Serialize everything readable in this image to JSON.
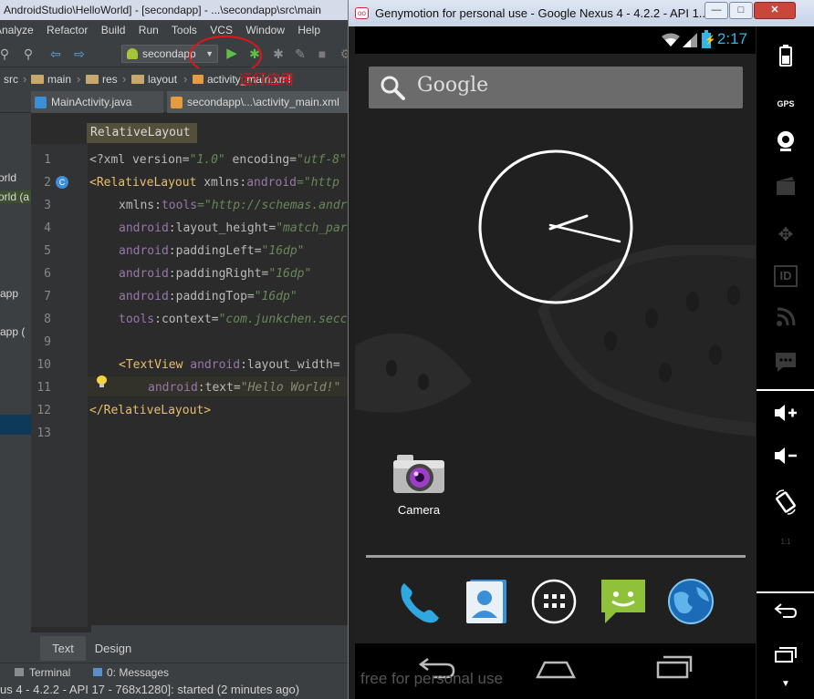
{
  "ide": {
    "title": "AndroidStudio\\HelloWorld] - [secondapp] - ...\\secondapp\\src\\main",
    "menu": [
      "Analyze",
      "Refactor",
      "Build",
      "Run",
      "Tools",
      "VCS",
      "Window",
      "Help"
    ],
    "run_config": "secondapp",
    "annotation": "运行应用",
    "breadcrumb": [
      "src",
      "main",
      "res",
      "layout",
      "activity_main.xml"
    ],
    "tabs": [
      "MainActivity.java",
      "secondapp\\...\\activity_main.xml"
    ],
    "project_items": [
      "orld",
      "orld (a",
      "app",
      "app ("
    ],
    "editor_crumb": "RelativeLayout",
    "line_numbers": [
      "1",
      "2",
      "3",
      "4",
      "5",
      "6",
      "7",
      "8",
      "9",
      "10",
      "11",
      "12",
      "13"
    ],
    "code": {
      "l1": {
        "a": "<?xml ",
        "b": "version=",
        "c": "\"1.0\"",
        "d": " encoding=",
        "e": "\"utf-8\""
      },
      "l2": {
        "tag": "<RelativeLayout",
        "ns": "android",
        "attr": " xmlns:",
        "val": "=\"http"
      },
      "l3": {
        "attr": "xmlns:",
        "ns": "tools",
        "val": "=\"http://schemas.andr"
      },
      "l4": {
        "ns": "android",
        "attr": ":layout_height=",
        "val": "\"match_par"
      },
      "l5": {
        "ns": "android",
        "attr": ":paddingLeft=",
        "val": "\"16dp\""
      },
      "l6": {
        "ns": "android",
        "attr": ":paddingRight=",
        "val": "\"16dp\""
      },
      "l7": {
        "ns": "android",
        "attr": ":paddingTop=",
        "val": "\"16dp\""
      },
      "l8": {
        "ns": "tools",
        "attr": ":context=",
        "val": "\"com.junkchen.secc"
      },
      "l10": {
        "tag": "<TextView",
        "ns": "android",
        "attr": ":layout_width="
      },
      "l11": {
        "ns": "android",
        "attr": ":text=",
        "val": "\"Hello World!\""
      },
      "l12": {
        "tag": "</RelativeLayout>"
      }
    },
    "bottom_tabs": [
      "Text",
      "Design"
    ],
    "tool_windows": [
      "Terminal",
      "0: Messages"
    ],
    "status": "us 4 - 4.2.2 - API 17 - 768x1280]: started (2 minutes ago)"
  },
  "emulator": {
    "title": "Genymotion for personal use - Google Nexus 4 - 4.2.2 - API 1...",
    "time": "2:17",
    "search_hint": "Google",
    "camera_label": "Camera",
    "watermark": "free for personal use",
    "sidebar_gps": "GPS",
    "sidebar_id": "ID",
    "sidebar_ratio": "1:1"
  },
  "colors": {
    "accent": "#33b5e5",
    "annotation": "#e0161b",
    "caret_line": "#32322a"
  }
}
